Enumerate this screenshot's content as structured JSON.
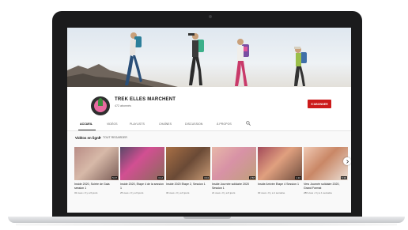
{
  "channel": {
    "name": "TREK ELLES MARCHENT",
    "subscribers": "472 abonnés",
    "subscribe_label": "S'ABONNER"
  },
  "tabs": [
    {
      "label": "ACCUEIL",
      "active": true
    },
    {
      "label": "VIDÉOS",
      "active": false
    },
    {
      "label": "PLAYLISTS",
      "active": false
    },
    {
      "label": "CHAÎNES",
      "active": false
    },
    {
      "label": "DISCUSSION",
      "active": false
    },
    {
      "label": "À PROPOS",
      "active": false
    }
  ],
  "section": {
    "title": "Vidéos en ligne",
    "play_all": "TOUT REGARDER"
  },
  "videos": [
    {
      "title": "Inside 2020, Soirée de Gala session 1",
      "meta": "32 vues • Il y a 6 jours",
      "duration": "5:47"
    },
    {
      "title": "Inside 2020, Étape 4 de la session 1",
      "meta": "25 vues • Il y a 6 jours",
      "duration": "3:12"
    },
    {
      "title": "Inside 2020 Étape 2, Session 1",
      "meta": "30 vues • Il y a 6 jours",
      "duration": "3:04"
    },
    {
      "title": "Inside Journée solidaire 2020 Session 1",
      "meta": "21 vues • Il y a 6 jours",
      "duration": "2:58"
    },
    {
      "title": "Inside Arrivée Étape 4 Session 1",
      "meta": "30 vues • Il y a 1 semaine",
      "duration": "1:10"
    },
    {
      "title": "Vers Journée solidaire 2020, Grand Format",
      "meta": "286 vues • Il y a 1 semaine",
      "duration": "5:39"
    }
  ],
  "colors": {
    "subscribe": "#cc1a1a",
    "background": "#f9f9f9",
    "bezel": "#1b1b1c"
  }
}
